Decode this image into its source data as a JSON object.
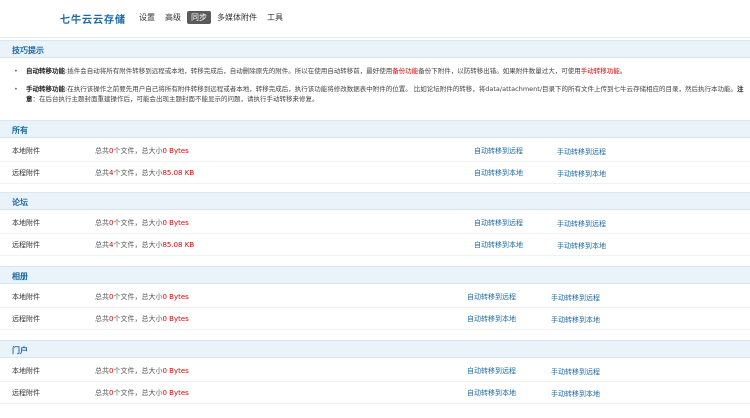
{
  "brand": "七牛云云存储",
  "nav": {
    "tabs": [
      "设置",
      "高级",
      "同步",
      "多媒体附件",
      "工具"
    ],
    "active_index": 2
  },
  "tips": {
    "title": "技巧提示",
    "tip1": {
      "bullet": "•",
      "label": "自动转移功能",
      "text_a": ":插件会自动将所有附件转移到远程或本地，转移完成后，自动删除原先的附件。所以在使用自动转移前，最好使用",
      "red_a": "备份功能",
      "text_b": "备份下附件，以防转移出错。如果附件数量过大，可使用",
      "red_b": "手动转移功能",
      "text_c": "。"
    },
    "tip2": {
      "bullet": "•",
      "label": "手动转移功能",
      "text_a": ":在执行该操作之前要先用户自己将所有附件转移到远程或者本地，转移完成后，执行该功能将修改数据表中附件的位置。 比如论坛附件的转移，将data/attachment/目录下的所有文件上传到七牛云存储相应的目录，然后执行本功能。",
      "note_label": "注意",
      "text_b": "：在后台执行主题封面重建操作后，可能会出现主题封面不能显示的问题，请执行手动转移来修复。"
    }
  },
  "sections": [
    {
      "title": "所有",
      "rows": [
        {
          "label": "本地附件",
          "pre": "总共",
          "count": "0",
          "mid": "个文件，总大小",
          "size": "0 Bytes",
          "auto": "自动转移到远程",
          "manual": "手动转移到远程"
        },
        {
          "label": "远程附件",
          "pre": "总共",
          "count": "4",
          "mid": "个文件，总大小",
          "size": "85.08 KB",
          "auto": "自动转移到本地",
          "manual": "手动转移到本地"
        }
      ]
    },
    {
      "title": "论坛",
      "rows": [
        {
          "label": "本地附件",
          "pre": "总共",
          "count": "0",
          "mid": "个文件，总大小",
          "size": "0 Bytes",
          "auto": "自动转移到远程",
          "manual": "手动转移到远程"
        },
        {
          "label": "远程附件",
          "pre": "总共",
          "count": "4",
          "mid": "个文件，总大小",
          "size": "85.08 KB",
          "auto": "自动转移到本地",
          "manual": "手动转移到本地"
        }
      ]
    },
    {
      "title": "相册",
      "rows": [
        {
          "label": "本地附件",
          "pre": "总共",
          "count": "0",
          "mid": "个文件，总大小",
          "size": "0 Bytes",
          "auto": "自动转移到远程",
          "manual": "手动转移到远程"
        },
        {
          "label": "远程附件",
          "pre": "总共",
          "count": "0",
          "mid": "个文件，总大小",
          "size": "0 Bytes",
          "auto": "自动转移到本地",
          "manual": "手动转移到本地"
        }
      ]
    },
    {
      "title": "门户",
      "rows": [
        {
          "label": "本地附件",
          "pre": "总共",
          "count": "0",
          "mid": "个文件，总大小",
          "size": "0 Bytes",
          "auto": "自动转移到远程",
          "manual": "手动转移到远程"
        },
        {
          "label": "远程附件",
          "pre": "总共",
          "count": "0",
          "mid": "个文件，总大小",
          "size": "0 Bytes",
          "auto": "自动转移到本地",
          "manual": "手动转移到本地"
        }
      ]
    }
  ]
}
